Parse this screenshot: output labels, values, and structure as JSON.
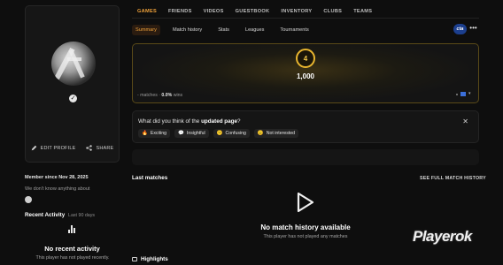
{
  "profile": {
    "edit_label": "EDIT PROFILE",
    "share_label": "SHARE",
    "member_since": "Member since Nov 28, 2025",
    "about": "We don't know anything about",
    "verified_icon": "check-badge-icon"
  },
  "recent_activity": {
    "title": "Recent Activity",
    "period": "Last 90 days",
    "empty_title": "No recent activity",
    "empty_subtitle": "This player has not played recently."
  },
  "nav": {
    "tabs": [
      "GAMES",
      "FRIENDS",
      "VIDEOS",
      "GUESTBOOK",
      "INVENTORY",
      "CLUBS",
      "TEAMS"
    ],
    "active": "GAMES"
  },
  "subtabs": {
    "items": [
      "Summary",
      "Match history",
      "Stats",
      "Leagues",
      "Tournaments"
    ],
    "active": "Summary",
    "game_badge": "cta",
    "more": "•••"
  },
  "summary": {
    "level": "4",
    "elo": "1,000",
    "matches_prefix": "-",
    "matches_label": "matches",
    "winrate": "0.0%",
    "wins_label": "wins",
    "accent_color": "#e8b52f"
  },
  "feedback": {
    "question_prefix": "What did you think of the",
    "question_bold": "updated page",
    "question_suffix": "?",
    "options": [
      {
        "emoji": "🔥",
        "label": "Exciting"
      },
      {
        "emoji": "💬",
        "label": "Insightful"
      },
      {
        "emoji": "😕",
        "label": "Confusing"
      },
      {
        "emoji": "😐",
        "label": "Not interested"
      }
    ],
    "close": "✕"
  },
  "matches": {
    "title": "Last matches",
    "see_full": "SEE FULL MATCH HISTORY",
    "empty_title": "No match history available",
    "empty_subtitle": "This player has not played any matches"
  },
  "highlights": {
    "title": "Highlights"
  },
  "watermark": "Playerok"
}
